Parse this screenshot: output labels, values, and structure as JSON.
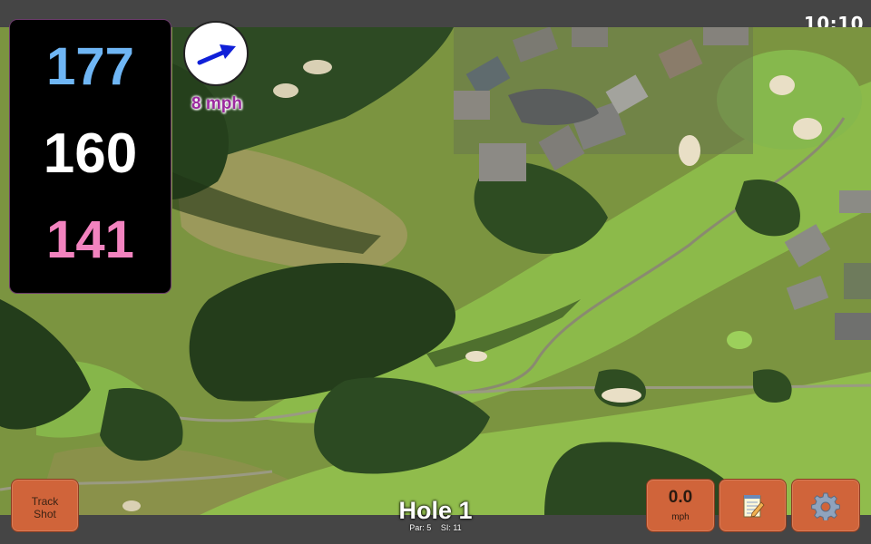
{
  "status_bar": {
    "time": "10:10"
  },
  "yardages": {
    "back": "177",
    "middle": "160",
    "front": "141"
  },
  "yardage_colors": {
    "back": "#6fb6f5",
    "middle": "#ffffff",
    "front": "#f283bf"
  },
  "wind": {
    "speed_label": "8 mph",
    "direction_icon": "wind-arrow-icon"
  },
  "hole": {
    "title": "Hole 1",
    "par_label": "Par: 5",
    "si_label": "SI: 11"
  },
  "buttons": {
    "track_shot_line1": "Track",
    "track_shot_line2": "Shot",
    "speed_value": "0.0",
    "speed_unit": "mph",
    "notes_icon": "notepad-icon",
    "settings_icon": "gear-icon"
  },
  "colors": {
    "button": "#d0643a",
    "panel": "#000000",
    "wind_text": "#9b2a9f"
  }
}
